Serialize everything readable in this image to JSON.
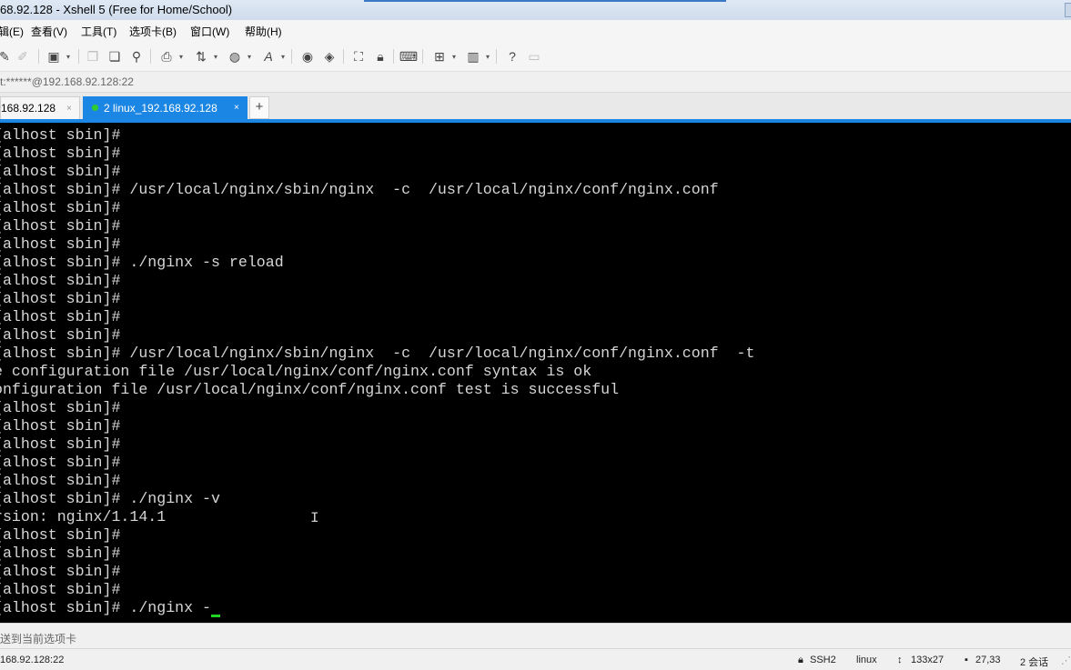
{
  "window": {
    "title": "68.92.128 - Xshell 5 (Free for Home/School)"
  },
  "menu": [
    "辑(E)",
    "查看(V)",
    "工具(T)",
    "选项卡(B)",
    "窗口(W)",
    "帮助(H)"
  ],
  "toolbar": {
    "icons": [
      "wand-icon",
      "brush-icon",
      "properties-icon",
      "copy-icon",
      "paste-icon",
      "find-icon",
      "print-icon",
      "transfer-icon",
      "globe-icon",
      "font-icon",
      "xftp-icon",
      "script-icon",
      "fullscreen-icon",
      "lock-icon",
      "keyboard-icon",
      "new-tab-icon",
      "layout-icon",
      "help-icon",
      "chat-icon"
    ]
  },
  "address": {
    "value": "t:******@192.168.92.128:22"
  },
  "tabs": [
    {
      "label": "168.92.128",
      "close": "×",
      "active": false
    },
    {
      "label": "2 linux_192.168.92.128",
      "close": "×",
      "active": true,
      "status_color": "#2fcb2f"
    }
  ],
  "new_tab_label": "+",
  "terminal": {
    "lines": [
      "[alhost sbin]#",
      "[alhost sbin]#",
      "[alhost sbin]#",
      "[alhost sbin]# /usr/local/nginx/sbin/nginx  -c  /usr/local/nginx/conf/nginx.conf",
      "[alhost sbin]#",
      "[alhost sbin]#",
      "[alhost sbin]#",
      "[alhost sbin]# ./nginx -s reload",
      "[alhost sbin]#",
      "[alhost sbin]#",
      "[alhost sbin]#",
      "[alhost sbin]#",
      "[alhost sbin]# /usr/local/nginx/sbin/nginx  -c  /usr/local/nginx/conf/nginx.conf  -t",
      "e configuration file /usr/local/nginx/conf/nginx.conf syntax is ok",
      "onfiguration file /usr/local/nginx/conf/nginx.conf test is successful",
      "[alhost sbin]#",
      "[alhost sbin]#",
      "[alhost sbin]#",
      "[alhost sbin]#",
      "[alhost sbin]#",
      "[alhost sbin]# ./nginx -v",
      "rsion: nginx/1.14.1",
      "[alhost sbin]#",
      "[alhost sbin]#",
      "[alhost sbin]#",
      "[alhost sbin]#",
      "[alhost sbin]# ./nginx -"
    ],
    "cursor_color": "#23d323"
  },
  "send_bar": {
    "text": "送到当前选项卡"
  },
  "status": {
    "host": "168.92.128:22",
    "protocol": "SSH2",
    "os": "linux",
    "size": "133x27",
    "position": "27,33",
    "sessions": "2 会话"
  }
}
